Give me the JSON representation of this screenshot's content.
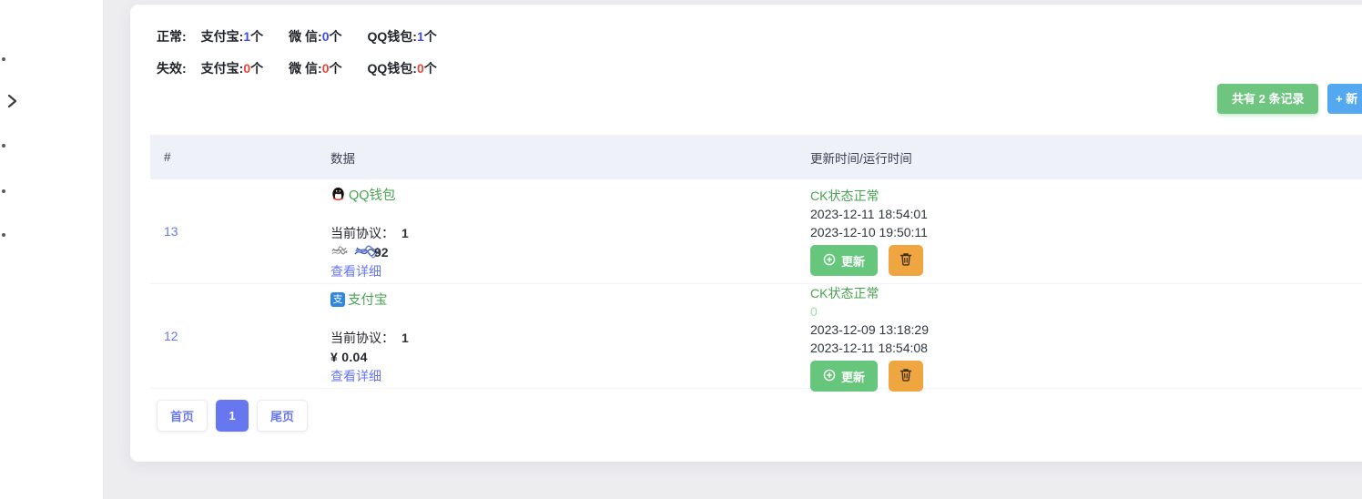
{
  "stats": {
    "normal": {
      "label": "正常:",
      "items": [
        {
          "name": "支付宝:",
          "value": "1",
          "suffix": "个"
        },
        {
          "name": "微 信:",
          "value": "0",
          "suffix": "个"
        },
        {
          "name": "QQ钱包:",
          "value": "1",
          "suffix": "个"
        }
      ]
    },
    "invalid": {
      "label": "失效:",
      "items": [
        {
          "name": "支付宝:",
          "value": "0",
          "suffix": "个"
        },
        {
          "name": "微 信:",
          "value": "0",
          "suffix": "个"
        },
        {
          "name": "QQ钱包:",
          "value": "0",
          "suffix": "个"
        }
      ]
    }
  },
  "toolbar": {
    "record_count_label": "共有 2 条记录",
    "add_button_label": "+ 新"
  },
  "table": {
    "headers": {
      "id": "#",
      "data": "数据",
      "time": "更新时间/运行时间"
    },
    "rows": [
      {
        "id": "13",
        "wallet_name": "QQ钱包",
        "wallet_type": "qq",
        "protocol_label": "当前协议：",
        "protocol_value": "1",
        "amount_visible": "92",
        "amount_redacted": true,
        "detail_link": "查看详细",
        "status": "CK状态正常",
        "update_time": "2023-12-11 18:54:01",
        "run_time": "2023-12-10 19:50:11",
        "update_button": "更新"
      },
      {
        "id": "12",
        "wallet_name": "支付宝",
        "wallet_type": "alipay",
        "protocol_label": "当前协议：",
        "protocol_value": "1",
        "amount": "¥ 0.04",
        "detail_link": "查看详细",
        "status": "CK状态正常",
        "faint_value": "0",
        "update_time": "2023-12-09 13:18:29",
        "run_time": "2023-12-11 18:54:08",
        "update_button": "更新"
      }
    ]
  },
  "pagination": {
    "first": "首页",
    "current": "1",
    "last": "尾页"
  },
  "icons": {
    "alipay_char": "支"
  },
  "colors": {
    "accent_indigo": "#6777ef",
    "stat_blue": "#3e4df0",
    "stat_red": "#e8453c",
    "success_green_text": "#47a34f",
    "faint_green": "#9be0a9",
    "button_green": "#66c67b",
    "button_orange": "#f0a640",
    "button_blue": "#54a8f0",
    "table_header_bg": "#eff1f9",
    "page_bg": "#ededf0"
  }
}
